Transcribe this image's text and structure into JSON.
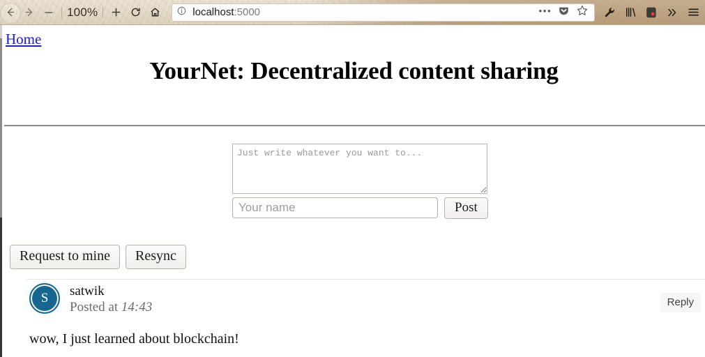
{
  "browser": {
    "back_label": "Back",
    "forward_label": "Forward",
    "zoom_out_label": "Zoom out",
    "zoom_level": "100%",
    "zoom_in_label": "Zoom in",
    "reload_label": "Reload",
    "home_label": "Home",
    "address": {
      "host": "localhost",
      "port": ":5000",
      "site_info_icon": "info-circle-icon"
    },
    "page_actions_icon": "ellipsis-icon",
    "pocket_icon": "pocket-icon",
    "bookmark_icon": "star-icon",
    "toolbar_icons": [
      "wrench-icon",
      "library-icon",
      "evernote-icon",
      "chevron-double-right-icon",
      "hamburger-menu-icon"
    ]
  },
  "page": {
    "breadcrumb_home": "Home",
    "title": "YourNet: Decentralized content sharing"
  },
  "composer": {
    "message_placeholder": "Just write whatever you want to...",
    "name_placeholder": "Your name",
    "post_label": "Post"
  },
  "actions": {
    "mine_label": "Request to mine",
    "resync_label": "Resync"
  },
  "posts": [
    {
      "avatar_initial": "S",
      "avatar_color": "#16678f",
      "author": "satwik",
      "posted_prefix": "Posted at ",
      "time": "14:43",
      "reply_label": "Reply",
      "body": "wow, I just learned about blockchain!"
    }
  ]
}
